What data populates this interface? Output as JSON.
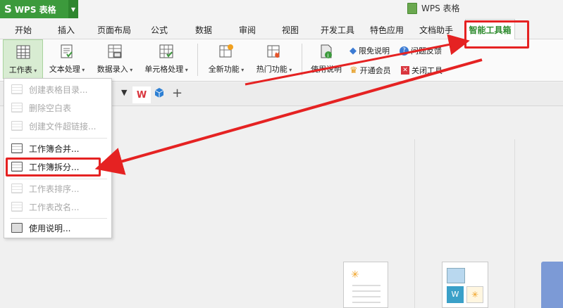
{
  "app": {
    "logo_text": "WPS 表格",
    "window_title": "WPS 表格"
  },
  "tabs": [
    "开始",
    "插入",
    "页面布局",
    "公式",
    "数据",
    "审阅",
    "视图",
    "开发工具",
    "特色应用",
    "文档助手"
  ],
  "active_tab": "智能工具箱",
  "ribbon": {
    "worksheet": "工作表",
    "text_processing": "文本处理",
    "data_entry": "数据录入",
    "cell_processing": "单元格处理",
    "new_features": "全新功能",
    "hot_features": "热门功能",
    "usage_guide": "使用说明",
    "disclaimer": "限免说明",
    "feedback": "问题反馈",
    "open_member": "开通会员",
    "close_tool": "关闭工具"
  },
  "menu": {
    "items": [
      {
        "label": "创建表格目录...",
        "enabled": false
      },
      {
        "label": "删除空白表",
        "enabled": false
      },
      {
        "label": "创建文件超链接...",
        "enabled": false
      },
      {
        "label": "工作簿合并...",
        "enabled": true
      },
      {
        "label": "工作簿拆分...",
        "enabled": true
      },
      {
        "label": "工作表排序...",
        "enabled": false
      },
      {
        "label": "工作表改名...",
        "enabled": false
      },
      {
        "label": "使用说明...",
        "enabled": true
      }
    ]
  },
  "doc_row": {
    "add_symbol": "+"
  },
  "colors": {
    "brand_green": "#3c9a3c",
    "active_tab_text": "#2e8b2e",
    "annotation_red": "#e52222"
  }
}
